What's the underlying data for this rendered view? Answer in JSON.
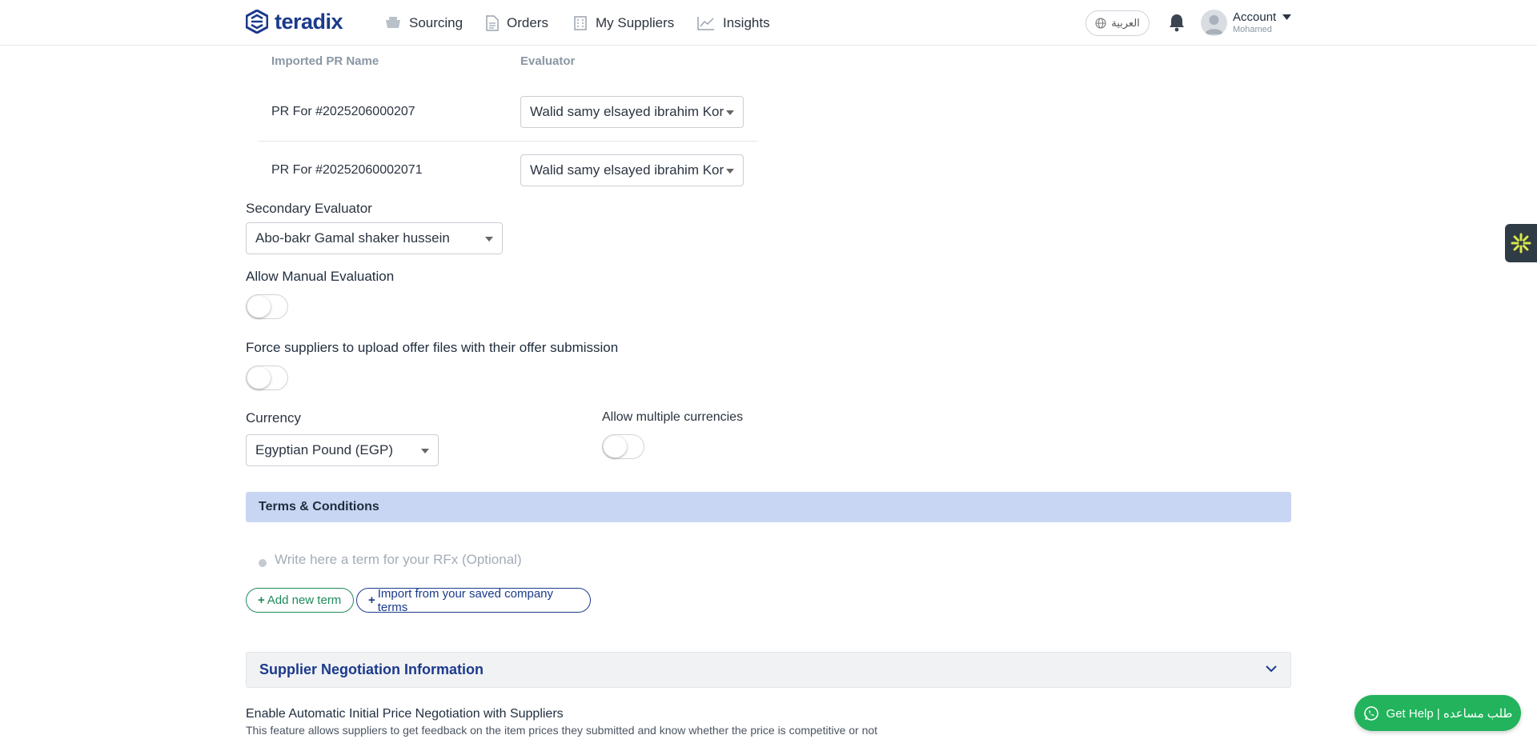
{
  "navbar": {
    "logo_text": "teradix",
    "items": [
      {
        "label": "Sourcing",
        "icon": "cart-icon"
      },
      {
        "label": "Orders",
        "icon": "document-icon"
      },
      {
        "label": "My Suppliers",
        "icon": "building-icon"
      },
      {
        "label": "Insights",
        "icon": "chart-line-icon"
      }
    ],
    "language_label": "العربية",
    "account_title": "Account",
    "account_name": "Mohamed"
  },
  "pr_table": {
    "col_name": "Imported PR Name",
    "col_evaluator": "Evaluator",
    "rows": [
      {
        "name": "PR For #2025206000207",
        "evaluator": "Walid samy elsayed ibrahim Kor"
      },
      {
        "name": "PR For #20252060002071",
        "evaluator": "Walid samy elsayed ibrahim Kor"
      }
    ]
  },
  "secondary_evaluator": {
    "label": "Secondary Evaluator",
    "value": "Abo-bakr Gamal shaker hussein"
  },
  "manual_evaluation": {
    "label": "Allow Manual Evaluation",
    "enabled": false
  },
  "force_upload": {
    "label": "Force suppliers to upload offer files with their offer submission",
    "enabled": false
  },
  "currency": {
    "label": "Currency",
    "value": "Egyptian Pound (EGP)"
  },
  "multiple_currencies": {
    "label": "Allow multiple currencies",
    "enabled": false
  },
  "terms": {
    "title": "Terms & Conditions",
    "placeholder": "Write here a term for your RFx (Optional)",
    "add_button": "Add new term",
    "import_button": "Import from your saved company terms",
    "plus": "+"
  },
  "negotiation": {
    "title": "Supplier Negotiation Information",
    "auto_title": "Enable Automatic Initial Price Negotiation with Suppliers",
    "auto_desc": "This feature allows suppliers to get feedback on the item prices they submitted and know whether the price is competitive or not"
  },
  "help_button": "Get Help | طلب مساعده",
  "colors": {
    "brand": "#1b3a8c",
    "terms_bar": "#c9d6f3",
    "green": "#1f8a5b",
    "help": "#22b35c"
  }
}
